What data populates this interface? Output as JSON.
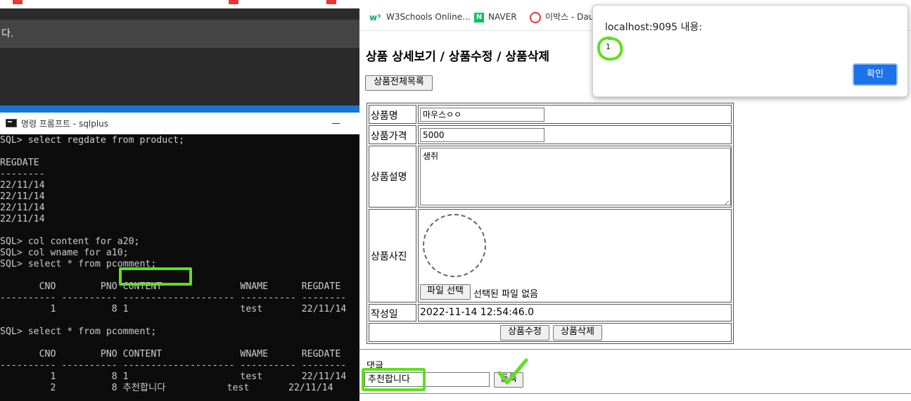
{
  "editor": {
    "line_text": "다."
  },
  "cmd": {
    "title": "명령 프롬프트 - sqlplus",
    "lines": [
      "SQL> select regdate from product;",
      "",
      "REGDATE",
      "--------",
      "22/11/14",
      "22/11/14",
      "22/11/14",
      "22/11/14",
      "",
      "SQL> col content for a20;",
      "SQL> col wname for a10;",
      "SQL> select * from pcomment;",
      "",
      "       CNO        PNO CONTENT              WNAME      REGDATE",
      "---------- ---------- -------------------- ---------- --------",
      "         1          8 1                    test       22/11/14",
      "",
      "SQL> select * from pcomment;",
      "",
      "       CNO        PNO CONTENT              WNAME      REGDATE",
      "---------- ---------- -------------------- ---------- --------",
      "         1          8 1                    test       22/11/14",
      "         2          8 추천합니다           test       22/11/14"
    ]
  },
  "bookmarks": [
    {
      "label": "W3Schools Online...",
      "icon": "w3schools-icon"
    },
    {
      "label": "NAVER",
      "icon": "naver-icon"
    },
    {
      "label": "이박스 - Dau",
      "icon": "ibaks-icon"
    }
  ],
  "page": {
    "title": "상품 상세보기 / 상품수정 / 상품삭제",
    "list_button": "상품전체목록",
    "fields": {
      "name_label": "상품명",
      "name_value": "마우스ㅇㅇ",
      "price_label": "상품가격",
      "price_value": "5000",
      "desc_label": "상품설명",
      "desc_value": "생쥐",
      "image_label": "상품사진",
      "file_button": "파일 선택",
      "file_status": "선택된 파일 없음",
      "date_label": "작성일",
      "date_value": "2022-11-14 12:54:46.0"
    },
    "update_button": "상품수정",
    "delete_button": "상품삭제",
    "comment": {
      "label": "댓글",
      "input_value": "추천합니다",
      "submit_button": "등록"
    }
  },
  "alert": {
    "title": "localhost:9095 내용:",
    "message": "1",
    "ok_button": "확인"
  },
  "colors": {
    "annotation_green": "#5ee01e",
    "alert_button": "#1a73e8",
    "console_bg": "#0c0c0c",
    "console_text": "#cccccc"
  }
}
